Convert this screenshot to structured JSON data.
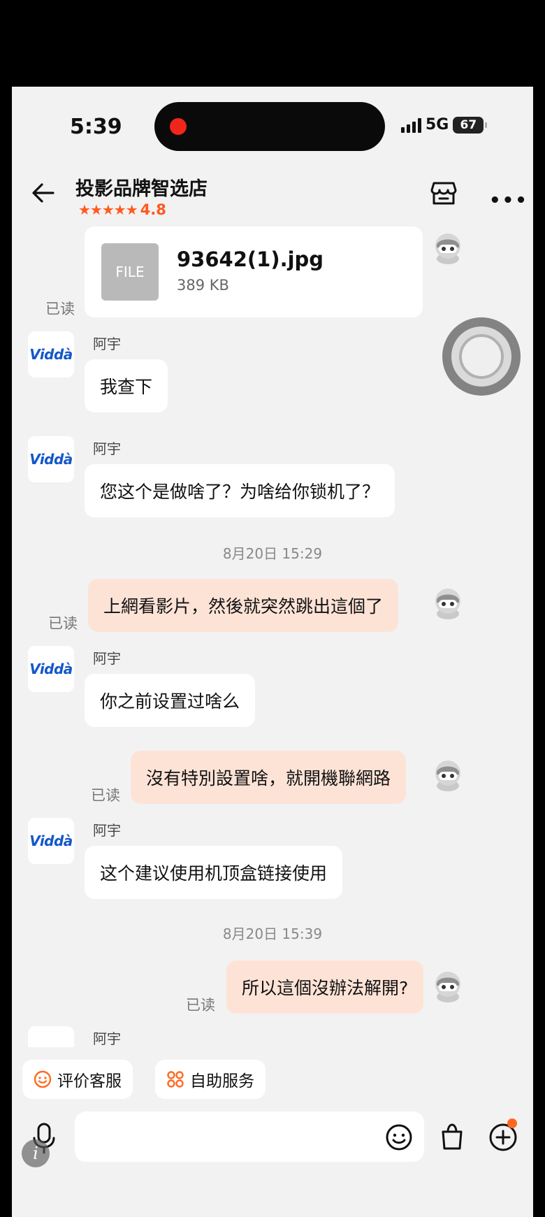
{
  "status_bar": {
    "time": "5:39",
    "network": "5G",
    "battery": "67"
  },
  "header": {
    "title": "投影品牌智选店",
    "stars": "★★★★★",
    "rating": "4.8"
  },
  "file": {
    "thumb_label": "FILE",
    "name": "93642(1).jpg",
    "size": "389 KB"
  },
  "read_label": "已读",
  "agent_name": "阿宇",
  "agent_logo": "Viddà",
  "messages": {
    "m1": "我查下",
    "m2": "您这个是做啥了？为啥给你锁机了？",
    "ts1": "8月20日 15:29",
    "m3": "上網看影片，然後就突然跳出這個了",
    "m4": "你之前设置过啥么",
    "m5": "沒有特別設置啥，就開機聯網路",
    "m6": "这个建议使用机顶盒链接使用",
    "ts2": "8月20日 15:39",
    "m7": "所以這個沒辦法解開?"
  },
  "quick_actions": {
    "rate": "评价客服",
    "self_service": "自助服务"
  },
  "colors": {
    "accent": "#ff5a1f",
    "mine_bubble": "#fde3d6",
    "brand_blue": "#1457c9"
  },
  "icons": [
    "back-arrow-icon",
    "store-icon",
    "more-icon",
    "robot-avatar-icon",
    "smile-icon",
    "grid-icon",
    "mic-icon",
    "emoji-icon",
    "bag-icon",
    "plus-icon",
    "info-icon"
  ]
}
